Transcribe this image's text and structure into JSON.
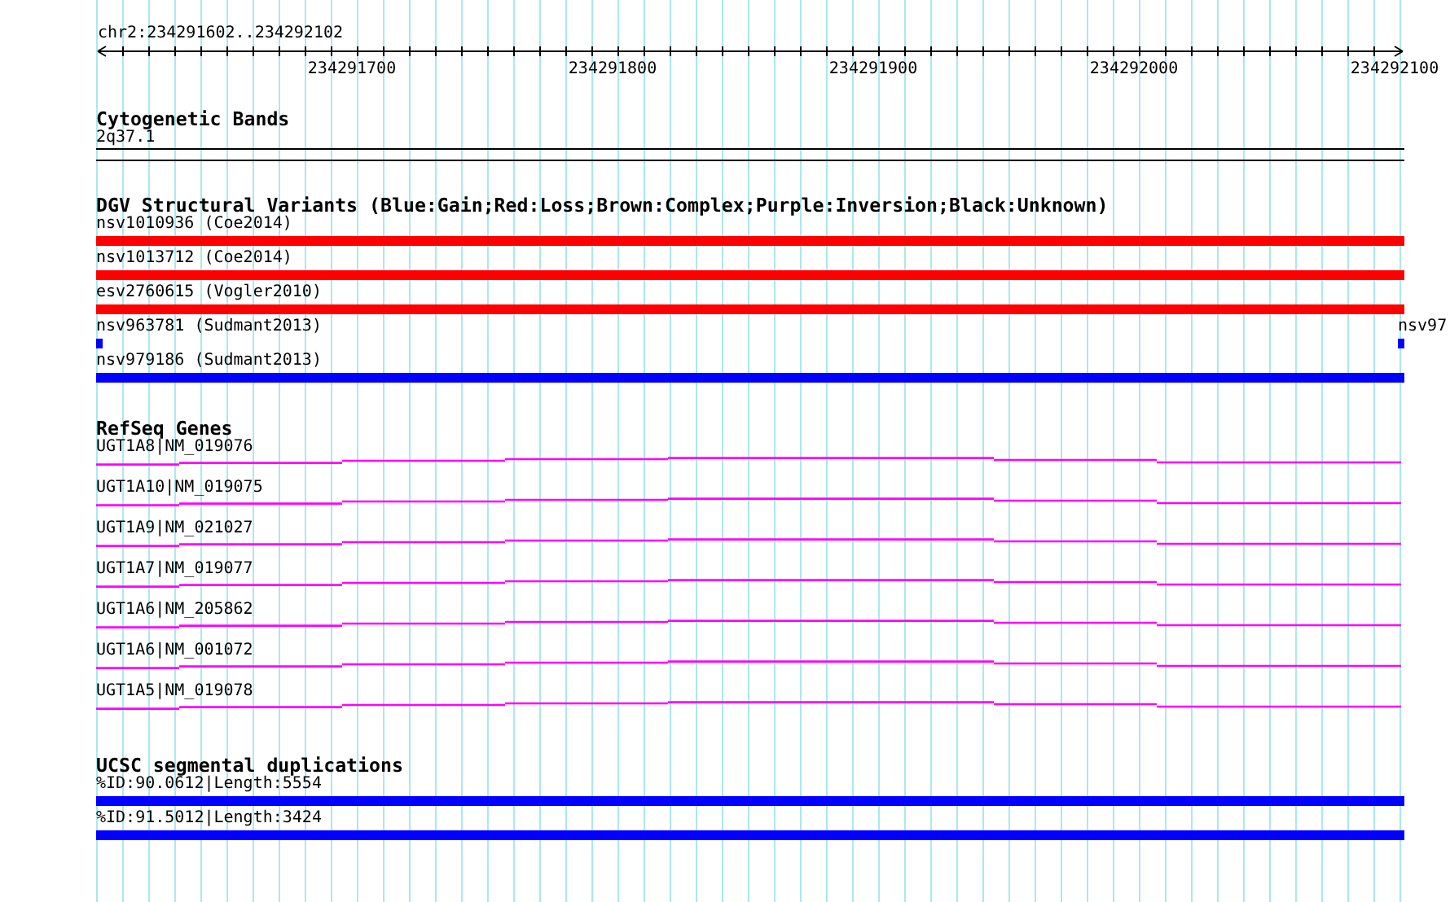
{
  "region": "chr2:234291602..234292102",
  "ruler": {
    "ticks": [
      "234291700",
      "234291800",
      "234291900",
      "234292000",
      "234292100"
    ]
  },
  "tracks": [
    {
      "kind": "cytoband",
      "title": "Cytogenetic Bands",
      "bands": [
        {
          "label": "2q37.1"
        }
      ]
    },
    {
      "kind": "variants",
      "title": "DGV Structural Variants (Blue:Gain;Red:Loss;Brown:Complex;Purple:Inversion;Black:Unknown)",
      "rows": [
        {
          "features": [
            {
              "label": "nsv1010936 (Coe2014)",
              "kind": "bar",
              "color": "#ff0000"
            }
          ]
        },
        {
          "features": [
            {
              "label": "nsv1013712 (Coe2014)",
              "kind": "bar",
              "color": "#ff0000"
            }
          ]
        },
        {
          "features": [
            {
              "label": "esv2760615 (Vogler2010)",
              "kind": "bar",
              "color": "#ff0000"
            }
          ]
        },
        {
          "features": [
            {
              "label": "nsv963781 (Sudmant2013)",
              "kind": "tick",
              "color": "#0000ff"
            },
            {
              "label": "nsv97",
              "kind": "tick",
              "color": "#0000ff"
            }
          ]
        },
        {
          "features": [
            {
              "label": "nsv979186 (Sudmant2013)",
              "kind": "bar",
              "color": "#0000ff"
            }
          ]
        }
      ]
    },
    {
      "kind": "genes",
      "title": "RefSeq Genes",
      "genes": [
        {
          "label": "UGT1A8|NM_019076"
        },
        {
          "label": "UGT1A10|NM_019075"
        },
        {
          "label": "UGT1A9|NM_021027"
        },
        {
          "label": "UGT1A7|NM_019077"
        },
        {
          "label": "UGT1A6|NM_205862"
        },
        {
          "label": "UGT1A6|NM_001072"
        },
        {
          "label": "UGT1A5|NM_019078"
        }
      ]
    },
    {
      "kind": "segdups",
      "title": "UCSC segmental duplications",
      "items": [
        {
          "label": "%ID:90.0612|Length:5554"
        },
        {
          "label": "%ID:91.5012|Length:3424"
        }
      ]
    }
  ]
}
